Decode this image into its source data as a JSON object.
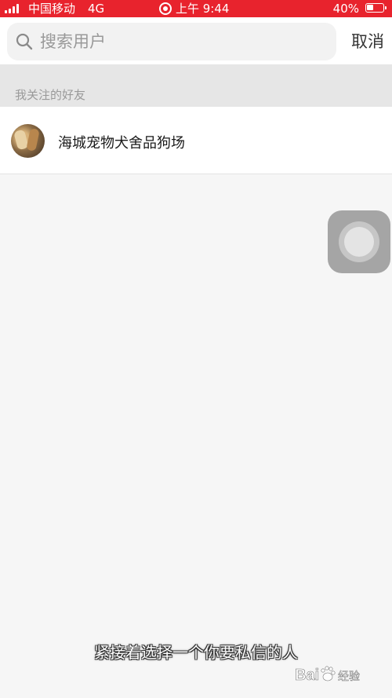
{
  "status_bar": {
    "carrier": "中国移动",
    "network": "4G",
    "time": "上午 9:44",
    "battery_percent": "40%",
    "signal_level": 1.0,
    "battery_level": 0.4,
    "background_color": "#e8232d"
  },
  "search": {
    "placeholder": "搜索用户",
    "value": "",
    "icon": "search-icon"
  },
  "header": {
    "cancel_label": "取消"
  },
  "section": {
    "label": "我关注的好友"
  },
  "contacts": [
    {
      "name": "海城宠物犬舍品狗场",
      "avatar": "dog-photo-avatar"
    }
  ],
  "caption": {
    "text": "紧接着选择一个你要私信的人"
  },
  "watermark": {
    "brand": "Baidu 经验"
  },
  "colors": {
    "accent": "#e8232d",
    "page_background": "#f6f6f6",
    "section_background": "#e6e6e6"
  }
}
